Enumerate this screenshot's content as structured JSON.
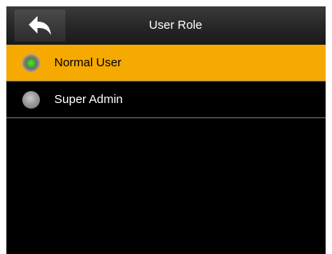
{
  "header": {
    "title": "User Role",
    "back_icon": "back-arrow-icon"
  },
  "options": [
    {
      "label": "Normal User",
      "selected": true
    },
    {
      "label": "Super Admin",
      "selected": false
    }
  ],
  "colors": {
    "selected_background": "#f6a900",
    "radio_selected": "#3ba020",
    "radio_unselected": "#9a9a9a",
    "screen_background": "#000000"
  }
}
